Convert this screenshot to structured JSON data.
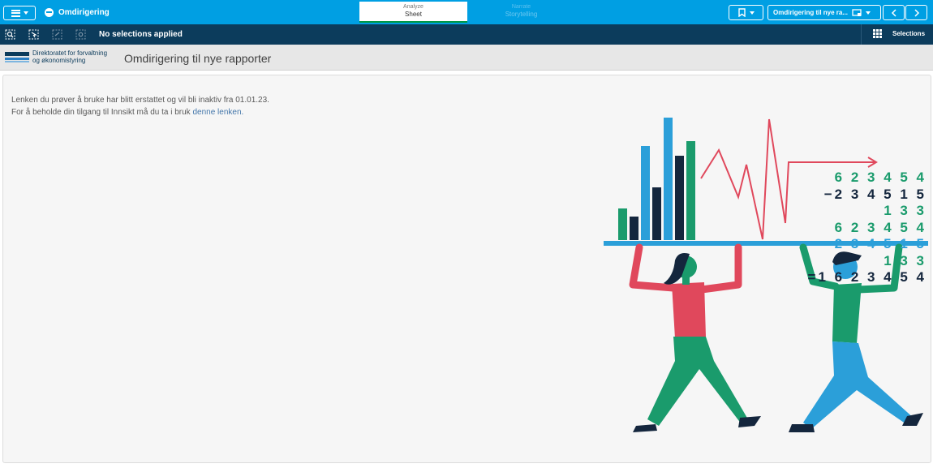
{
  "topbar": {
    "app_title": "Omdirigering",
    "tabs": [
      {
        "top": "Analyze",
        "bottom": "Sheet"
      },
      {
        "top": "Narrate",
        "bottom": "Storytelling"
      }
    ],
    "sheet_selector": "Omdirigering til nye ra...",
    "icons": {
      "menu": "hamburger-icon",
      "app": "app-chat-icon",
      "bookmark": "bookmark-icon",
      "sheet": "sheet-display-icon",
      "prev": "chevron-left-icon",
      "next": "chevron-right-icon"
    }
  },
  "selection_bar": {
    "status": "No selections applied",
    "selections_label": "Selections",
    "tools": [
      "smart-search-icon",
      "selections-tool-icon",
      "step-back-icon",
      "clear-selections-icon"
    ]
  },
  "sheet_header": {
    "logo_line1": "Direktoratet for forvaltning",
    "logo_line2": "og økonomistyring",
    "title": "Omdirigering til nye rapporter"
  },
  "content": {
    "line1": "Lenken du prøver å bruke har blitt erstattet og vil bli inaktiv fra 01.01.23.",
    "line2_prefix": "For å beholde din tilgang til Innsikt må du ta i bruk",
    "link_text": "denne lenken."
  },
  "illustration": {
    "numbers": [
      "6 2 3 4 5 4",
      "−2 3 4 5 1 5",
      "1 3 3",
      "6 2 3 4 5 4",
      "−2 3 4 5 1 5",
      "1 3 3",
      "=1 6 2 3 4 5 4"
    ]
  },
  "colors": {
    "topbar": "#009fe3",
    "selection_bar": "#0c3c5c",
    "header_bg": "#e7e7e7",
    "green": "#1a9b6c",
    "red": "#e0485c",
    "blue": "#2b9fd9",
    "navy": "#14263d"
  }
}
